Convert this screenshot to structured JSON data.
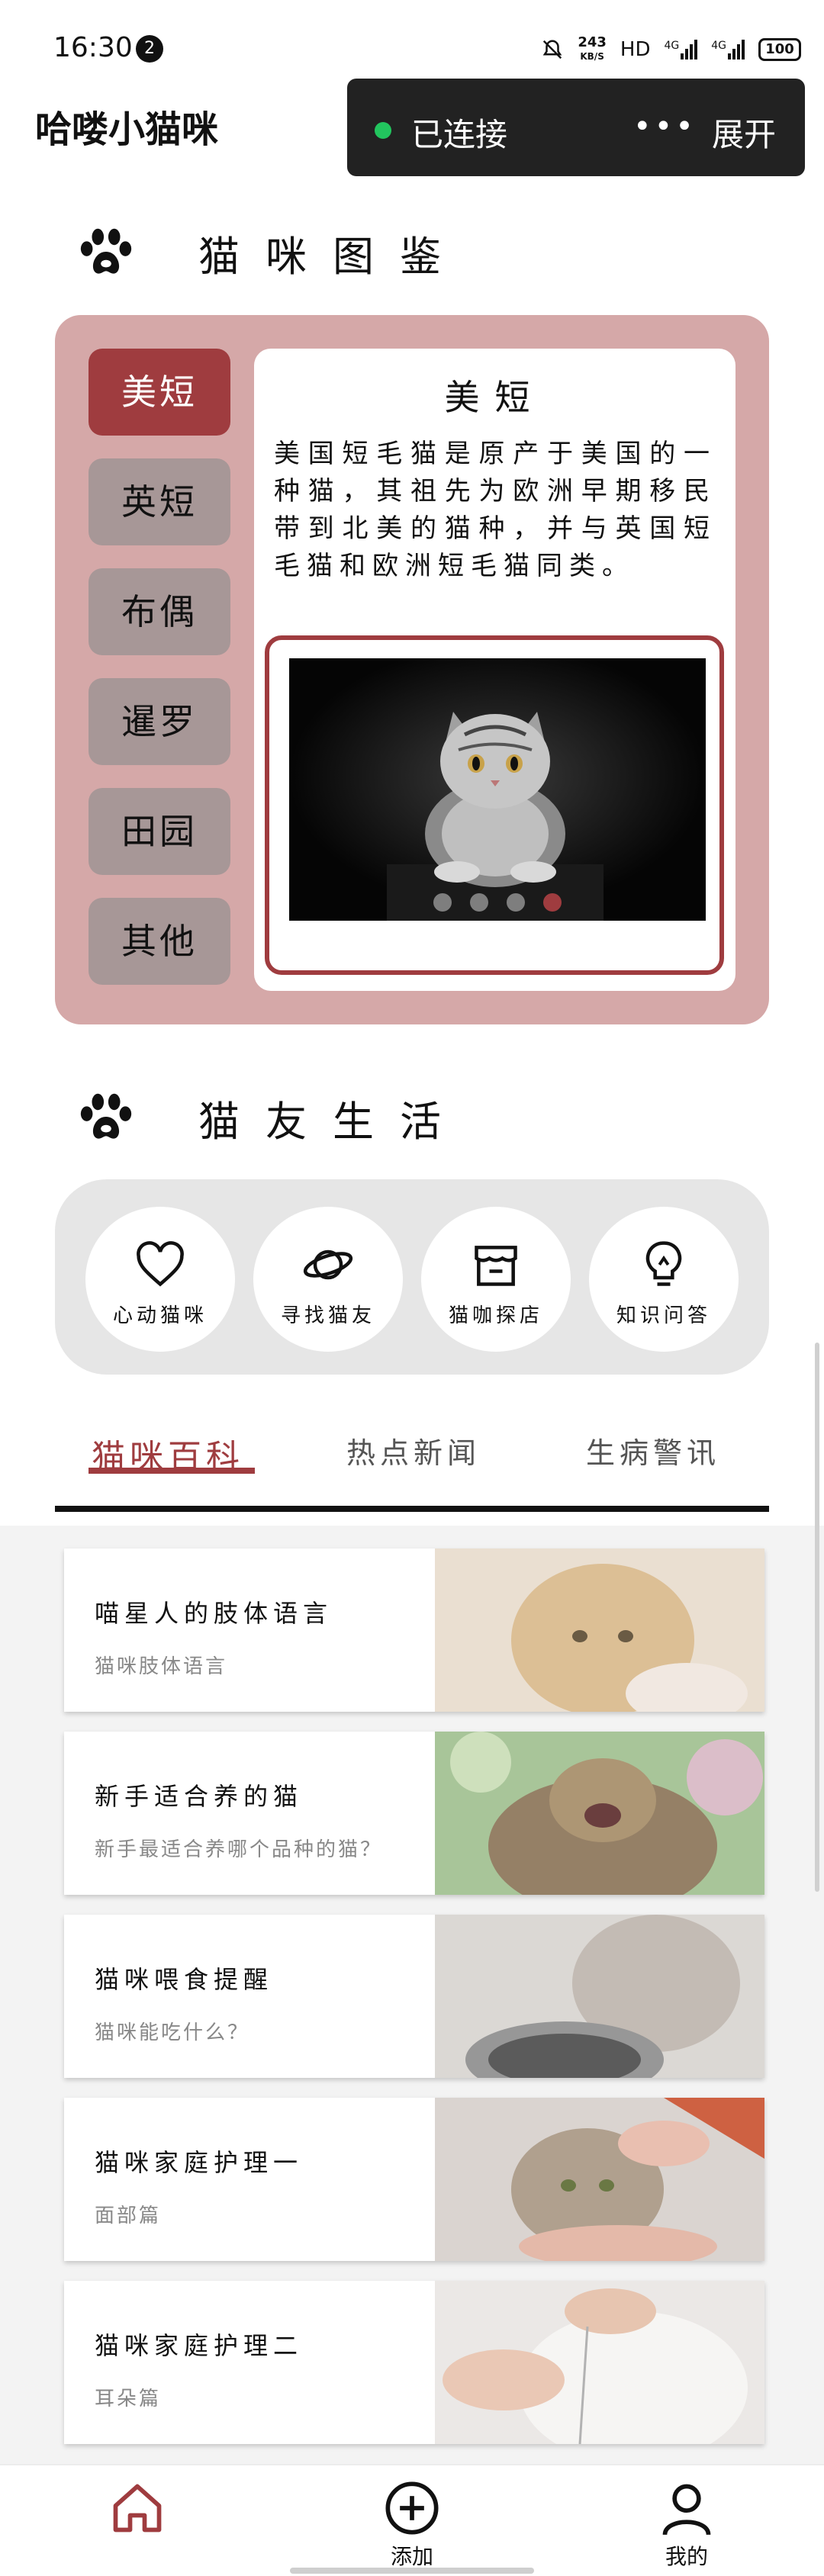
{
  "status_bar": {
    "time": "16:30",
    "notification_count": "2",
    "net_speed_value": "243",
    "net_speed_unit": "KB/S",
    "hd_label": "HD",
    "signal1_label": "4G",
    "signal2_label": "4G",
    "battery": "100"
  },
  "app": {
    "title": "哈喽小猫咪"
  },
  "connection": {
    "status": "已连接",
    "more": "•••",
    "expand": "展开",
    "status_color": "#22c55e"
  },
  "encyclopedia": {
    "title": "猫咪图鉴",
    "tabs": [
      "美短",
      "英短",
      "布偶",
      "暹罗",
      "田园",
      "其他"
    ],
    "active_index": 0,
    "selected": {
      "name": "美短",
      "description": "美国短毛猫是原产于美国的一种猫，其祖先为欧洲早期移民带到北美的猫种，并与英国短毛猫和欧洲短毛猫同类。"
    },
    "carousel": {
      "count": 4,
      "active": 3
    }
  },
  "life": {
    "title": "猫友生活",
    "actions": [
      {
        "label": "心动猫咪",
        "icon": "heart-icon"
      },
      {
        "label": "寻找猫友",
        "icon": "planet-icon"
      },
      {
        "label": "猫咖探店",
        "icon": "shop-icon"
      },
      {
        "label": "知识问答",
        "icon": "lightbulb-icon"
      }
    ]
  },
  "tabs": {
    "items": [
      "猫咪百科",
      "热点新闻",
      "生病警讯"
    ],
    "active": 0
  },
  "articles": [
    {
      "title": "喵星人的肢体语言",
      "subtitle": "猫咪肢体语言"
    },
    {
      "title": "新手适合养的猫",
      "subtitle": "新手最适合养哪个品种的猫？"
    },
    {
      "title": "猫咪喂食提醒",
      "subtitle": "猫咪能吃什么？"
    },
    {
      "title": "猫咪家庭护理一",
      "subtitle": "面部篇"
    },
    {
      "title": "猫咪家庭护理二",
      "subtitle": "耳朵篇"
    }
  ],
  "bottom_nav": {
    "items": [
      {
        "label": "",
        "icon": "home-icon"
      },
      {
        "label": "添加",
        "icon": "add-circle-icon"
      },
      {
        "label": "我的",
        "icon": "user-icon"
      }
    ]
  },
  "theme": {
    "accent": "#9f3c3f",
    "panel": "#d5a8a8"
  }
}
